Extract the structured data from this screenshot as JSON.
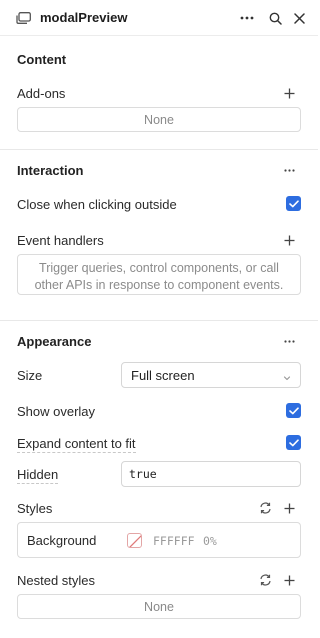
{
  "header": {
    "title": "modalPreview",
    "icons": [
      "modal-component-icon",
      "more-icon",
      "search-icon",
      "close-icon"
    ]
  },
  "content": {
    "title": "Content",
    "addons_label": "Add-ons",
    "addons_value": "None"
  },
  "interaction": {
    "title": "Interaction",
    "close_outside_label": "Close when clicking outside",
    "close_outside_checked": true,
    "event_handlers_label": "Event handlers",
    "event_handlers_hint": "Trigger queries, control components, or call other APIs in response to component events."
  },
  "appearance": {
    "title": "Appearance",
    "size_label": "Size",
    "size_value": "Full screen",
    "show_overlay_label": "Show overlay",
    "show_overlay_checked": true,
    "expand_label": "Expand content to fit",
    "expand_checked": true,
    "hidden_label": "Hidden",
    "hidden_value": "true",
    "styles_label": "Styles",
    "styles": [
      {
        "name": "Background",
        "hex": "FFFFFF",
        "opacity": "0%"
      }
    ],
    "nested_styles_label": "Nested styles",
    "nested_styles_value": "None"
  },
  "colors": {
    "accent": "#2d6de0",
    "border": "#dcdcdc",
    "muted_text": "#8a8a8a"
  }
}
